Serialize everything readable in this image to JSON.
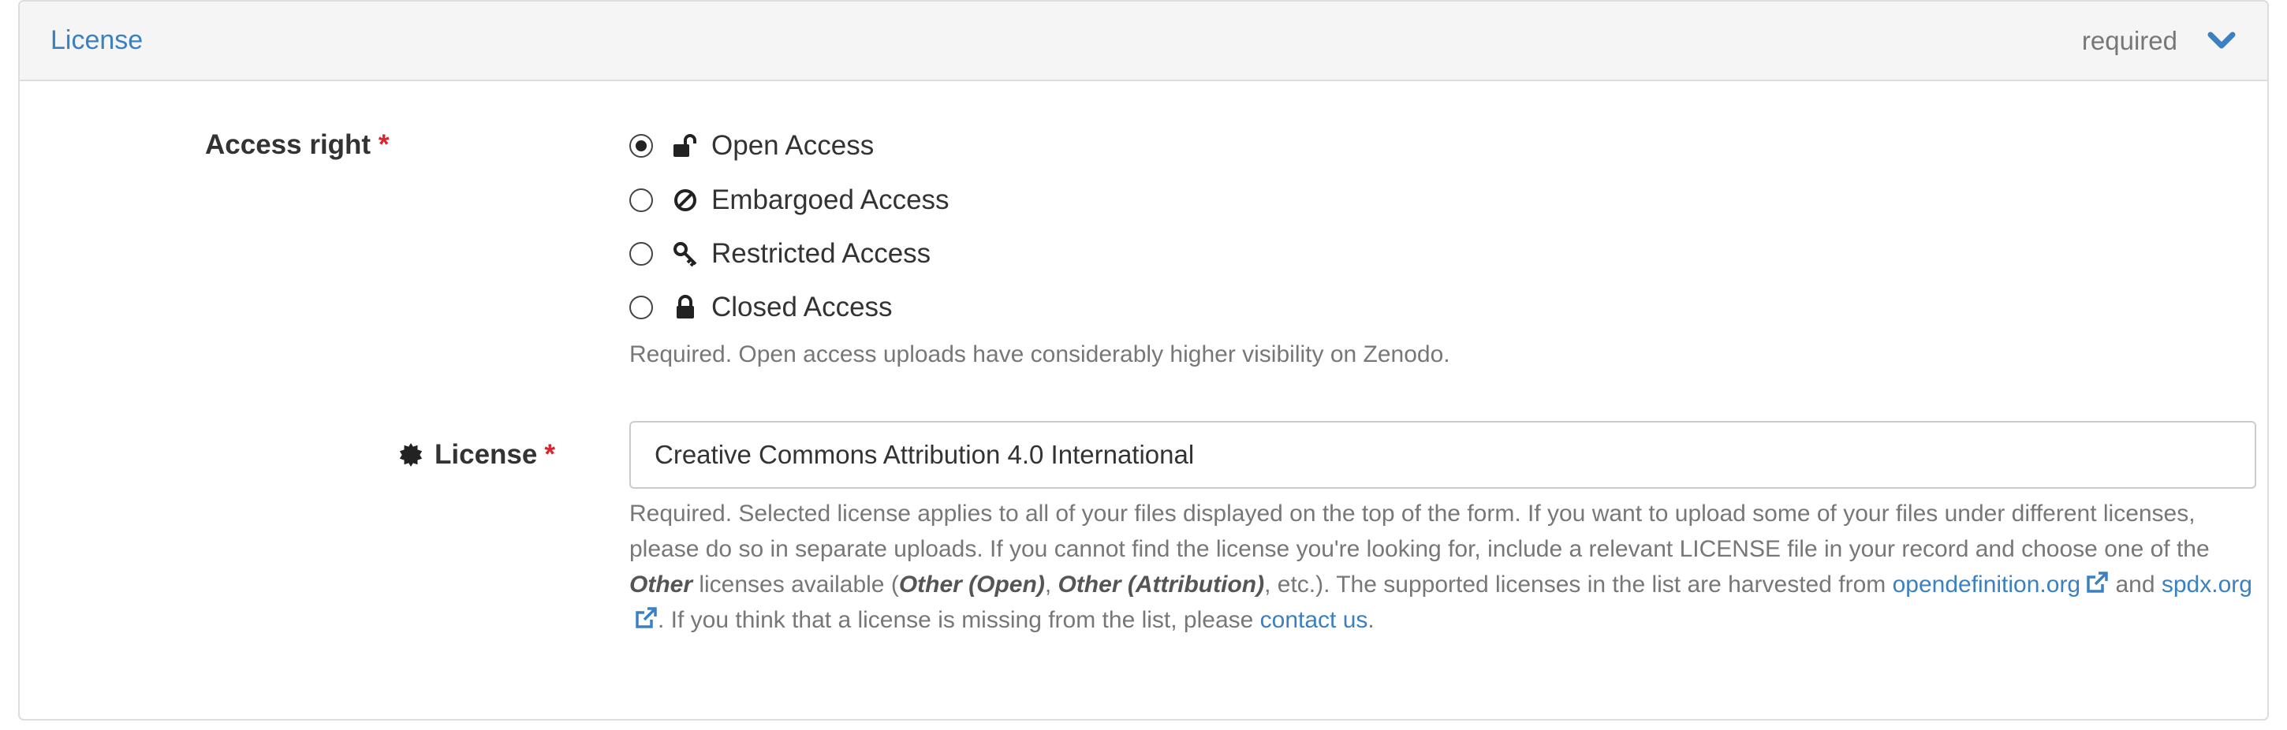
{
  "panel": {
    "title": "License",
    "required_text": "required"
  },
  "access_right": {
    "label": "Access right",
    "required_marker": "*",
    "options": [
      {
        "label": "Open Access",
        "icon": "unlock-icon",
        "checked": true
      },
      {
        "label": "Embargoed Access",
        "icon": "ban-icon",
        "checked": false
      },
      {
        "label": "Restricted Access",
        "icon": "key-icon",
        "checked": false
      },
      {
        "label": "Closed Access",
        "icon": "lock-icon",
        "checked": false
      }
    ],
    "help": "Required. Open access uploads have considerably higher visibility on Zenodo."
  },
  "license": {
    "label": "License",
    "required_marker": "*",
    "icon": "certificate-icon",
    "value": "Creative Commons Attribution 4.0 International",
    "help": {
      "part1": "Required. Selected license applies to all of your files displayed on the top of the form. If you want to upload some of your files under different licenses, please do so in separate uploads. If you cannot find the license you're looking for, include a relevant LICENSE file in your record and choose one of the ",
      "other_em": "Other",
      "part2": " licenses available (",
      "other_open_em": "Other (Open)",
      "comma": ", ",
      "other_attr_em": "Other (Attribution)",
      "part3": ", etc.). The supported licenses in the list are harvested from ",
      "link_opendefinition": "opendefinition.org",
      "and_text": " and ",
      "link_spdx": "spdx.org",
      "part4": ". If you think that a license is missing from the list, please ",
      "link_contact": "contact us",
      "period": "."
    }
  },
  "colors": {
    "link": "#3b80c0",
    "required_star": "#d9232d",
    "muted": "#777777"
  }
}
